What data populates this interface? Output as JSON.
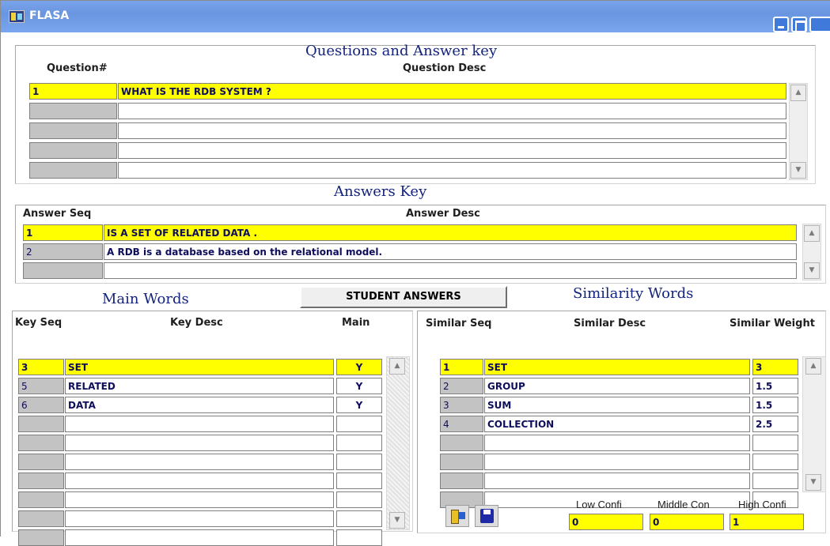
{
  "window": {
    "title": "FLASA"
  },
  "questions": {
    "title": "Questions and Answer key",
    "col_num": "Question#",
    "col_desc": "Question Desc",
    "rows": [
      {
        "num": "1",
        "desc": "WHAT IS THE RDB SYSTEM ?"
      },
      {
        "num": "",
        "desc": ""
      },
      {
        "num": "",
        "desc": ""
      },
      {
        "num": "",
        "desc": ""
      },
      {
        "num": "",
        "desc": ""
      }
    ]
  },
  "answers": {
    "title": "Answers Key",
    "col_seq": "Answer Seq",
    "col_desc": "Answer Desc",
    "rows": [
      {
        "seq": "1",
        "desc": "IS A SET OF RELATED DATA ."
      },
      {
        "seq": "2",
        "desc": "A RDB is a database based on the relational model."
      },
      {
        "seq": "",
        "desc": ""
      }
    ]
  },
  "student_answers_button": "STUDENT ANSWERS",
  "main_words": {
    "title": "Main Words",
    "col_seq": "Key Seq",
    "col_desc": "Key Desc",
    "col_main": "Main",
    "rows": [
      {
        "seq": "3",
        "desc": "SET",
        "main": "Y"
      },
      {
        "seq": "5",
        "desc": "RELATED",
        "main": "Y"
      },
      {
        "seq": "6",
        "desc": "DATA",
        "main": "Y"
      },
      {
        "seq": "",
        "desc": "",
        "main": ""
      },
      {
        "seq": "",
        "desc": "",
        "main": ""
      },
      {
        "seq": "",
        "desc": "",
        "main": ""
      },
      {
        "seq": "",
        "desc": "",
        "main": ""
      },
      {
        "seq": "",
        "desc": "",
        "main": ""
      },
      {
        "seq": "",
        "desc": "",
        "main": ""
      },
      {
        "seq": "",
        "desc": "",
        "main": ""
      }
    ]
  },
  "similarity": {
    "title": "Similarity Words",
    "col_seq": "Similar Seq",
    "col_desc": "Similar Desc",
    "col_weight": "Similar Weight",
    "rows": [
      {
        "seq": "1",
        "desc": "SET",
        "weight": "3"
      },
      {
        "seq": "2",
        "desc": "GROUP",
        "weight": "1.5"
      },
      {
        "seq": "3",
        "desc": "SUM",
        "weight": "1.5"
      },
      {
        "seq": "4",
        "desc": "COLLECTION",
        "weight": "2.5"
      },
      {
        "seq": "",
        "desc": "",
        "weight": ""
      },
      {
        "seq": "",
        "desc": "",
        "weight": ""
      },
      {
        "seq": "",
        "desc": "",
        "weight": ""
      },
      {
        "seq": "",
        "desc": "",
        "weight": ""
      }
    ]
  },
  "confidence": {
    "low_label": "Low Confi",
    "middle_label": "Middle Con",
    "high_label": "High Confi",
    "low_value": "0",
    "middle_value": "0",
    "high_value": "1"
  },
  "colors": {
    "titlebar": "#6a95e0",
    "section_title": "#13237e",
    "current_row": "#ffff00",
    "empty_seq": "#c3c3c3"
  },
  "icons": {
    "app": "flasa-app-icon",
    "exit": "exit-door-icon",
    "save": "save-floppy-icon"
  }
}
